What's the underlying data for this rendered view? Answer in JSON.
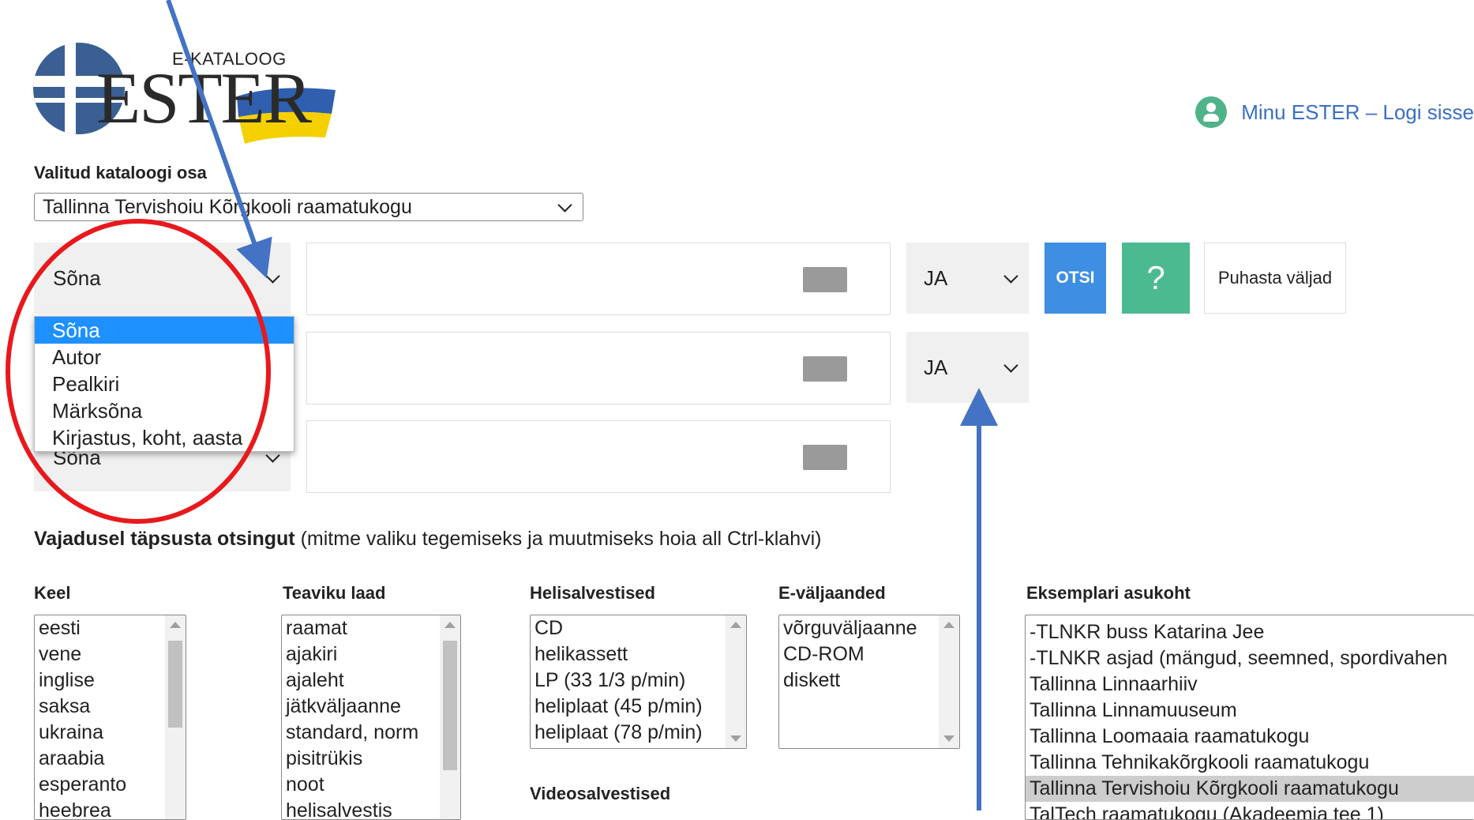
{
  "header": {
    "logo_subtitle": "E-KATALOOG",
    "logo_title": "ESTER",
    "login_link": "Minu ESTER – Logi sisse"
  },
  "catalog": {
    "label": "Valitud kataloogi osa",
    "selected": "Tallinna Tervishoiu Kõrgkooli raamatukogu"
  },
  "search": {
    "rows": [
      {
        "field": "Sõna",
        "value": "",
        "operator": "JA"
      },
      {
        "field": "Sõna",
        "value": "",
        "operator": "JA"
      },
      {
        "field": "Sõna",
        "value": ""
      }
    ],
    "search_button": "OTSI",
    "help_button": "?",
    "clear_button": "Puhasta väljad",
    "field_options": [
      "Sõna",
      "Autor",
      "Pealkiri",
      "Märksõna",
      "Kirjastus, koht, aasta"
    ]
  },
  "refine": {
    "bold_text": "Vajadusel täpsusta otsingut",
    "hint": "(mitme valiku tegemiseks ja muutmiseks hoia all Ctrl-klahvi)"
  },
  "filters": {
    "language": {
      "label": "Keel",
      "options": [
        "eesti",
        "vene",
        "inglise",
        "saksa",
        "ukraina",
        "araabia",
        "esperanto",
        "heebrea"
      ]
    },
    "material": {
      "label": "Teaviku laad",
      "options": [
        "raamat",
        "ajakiri",
        "ajaleht",
        "jätkväljaanne",
        "standard, norm",
        "pisitrükis",
        "noot",
        "helisalvestis"
      ]
    },
    "audio": {
      "label": "Helisalvestised",
      "options": [
        "CD",
        "helikassett",
        "LP (33 1/3 p/min)",
        "heliplaat (45 p/min)",
        "heliplaat (78 p/min)"
      ]
    },
    "video": {
      "label": "Videosalvestised"
    },
    "electronic": {
      "label": "E-väljaanded",
      "options": [
        "võrguväljaanne",
        "CD-ROM",
        "diskett"
      ]
    },
    "location": {
      "label": "Eksemplari asukoht",
      "options": [
        "-TLNKR buss Katarina Jee",
        "-TLNKR asjad (mängud, seemned, spordivahen",
        "Tallinna Linnaarhiiv",
        "Tallinna Linnamuuseum",
        "Tallinna Loomaaia raamatukogu",
        "Tallinna Tehnikakõrgkooli raamatukogu",
        "Tallinna Tervishoiu Kõrgkooli raamatukogu",
        "TalTech raamatukogu (Akadeemia tee 1)"
      ],
      "selected_index": 6
    }
  },
  "colors": {
    "search_button": "#3e8ee3",
    "help_button": "#4cba90",
    "dropdown_highlight": "#1e90ff",
    "annotation_circle": "#e8191c",
    "annotation_arrow": "#4472c4"
  }
}
